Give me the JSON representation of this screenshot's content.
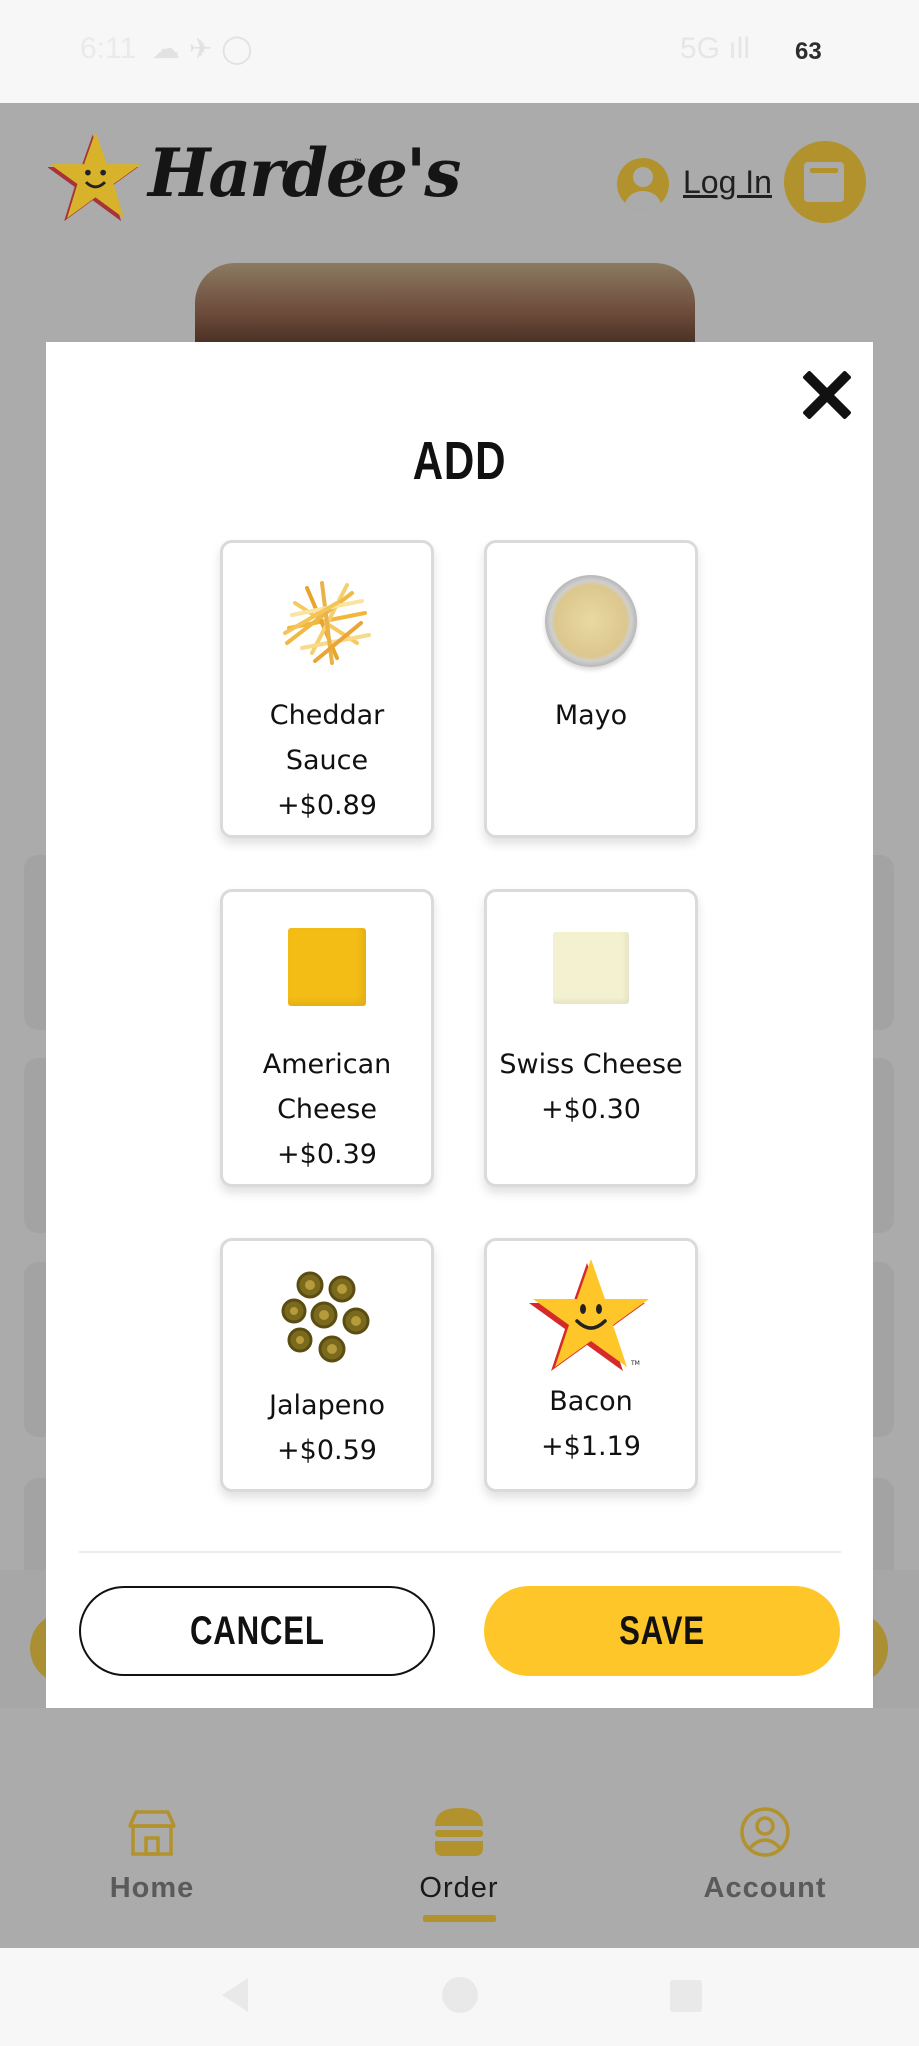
{
  "status_bar": {
    "time": "6:11",
    "icons": "☁ ✈ ◯",
    "network": "5G ıll",
    "battery": "63"
  },
  "header": {
    "brand": "Hardee's",
    "trademark": "™",
    "login_label": "Log In"
  },
  "modal": {
    "title": "ADD",
    "options": [
      {
        "name": "Cheddar Sauce",
        "name_lines": [
          "Cheddar",
          "Sauce"
        ],
        "price": "+$0.89",
        "icon": "shredded-cheese"
      },
      {
        "name": "Mayo",
        "name_lines": [
          "Mayo"
        ],
        "price": "",
        "icon": "mayo-cup"
      },
      {
        "name": "American Cheese",
        "name_lines": [
          "American",
          "Cheese"
        ],
        "price": "+$0.39",
        "icon": "american-cheese-slice"
      },
      {
        "name": "Swiss Cheese",
        "name_lines": [
          "Swiss Cheese"
        ],
        "price": "+$0.30",
        "icon": "swiss-cheese-slice"
      },
      {
        "name": "Jalapeno",
        "name_lines": [
          "Jalapeno"
        ],
        "price": "+$0.59",
        "icon": "jalapeno-slices"
      },
      {
        "name": "Bacon",
        "name_lines": [
          "Bacon"
        ],
        "price": "+$1.19",
        "icon": "star-logo"
      }
    ],
    "cancel_label": "CANCEL",
    "save_label": "SAVE"
  },
  "nav": {
    "items": [
      {
        "label": "Home",
        "icon": "home-icon"
      },
      {
        "label": "Order",
        "icon": "burger-icon",
        "active": true
      },
      {
        "label": "Account",
        "icon": "account-icon"
      }
    ]
  },
  "colors": {
    "accent_yellow": "#ffc629",
    "overlay_gray": "#ababab",
    "text_dark": "#111111"
  }
}
